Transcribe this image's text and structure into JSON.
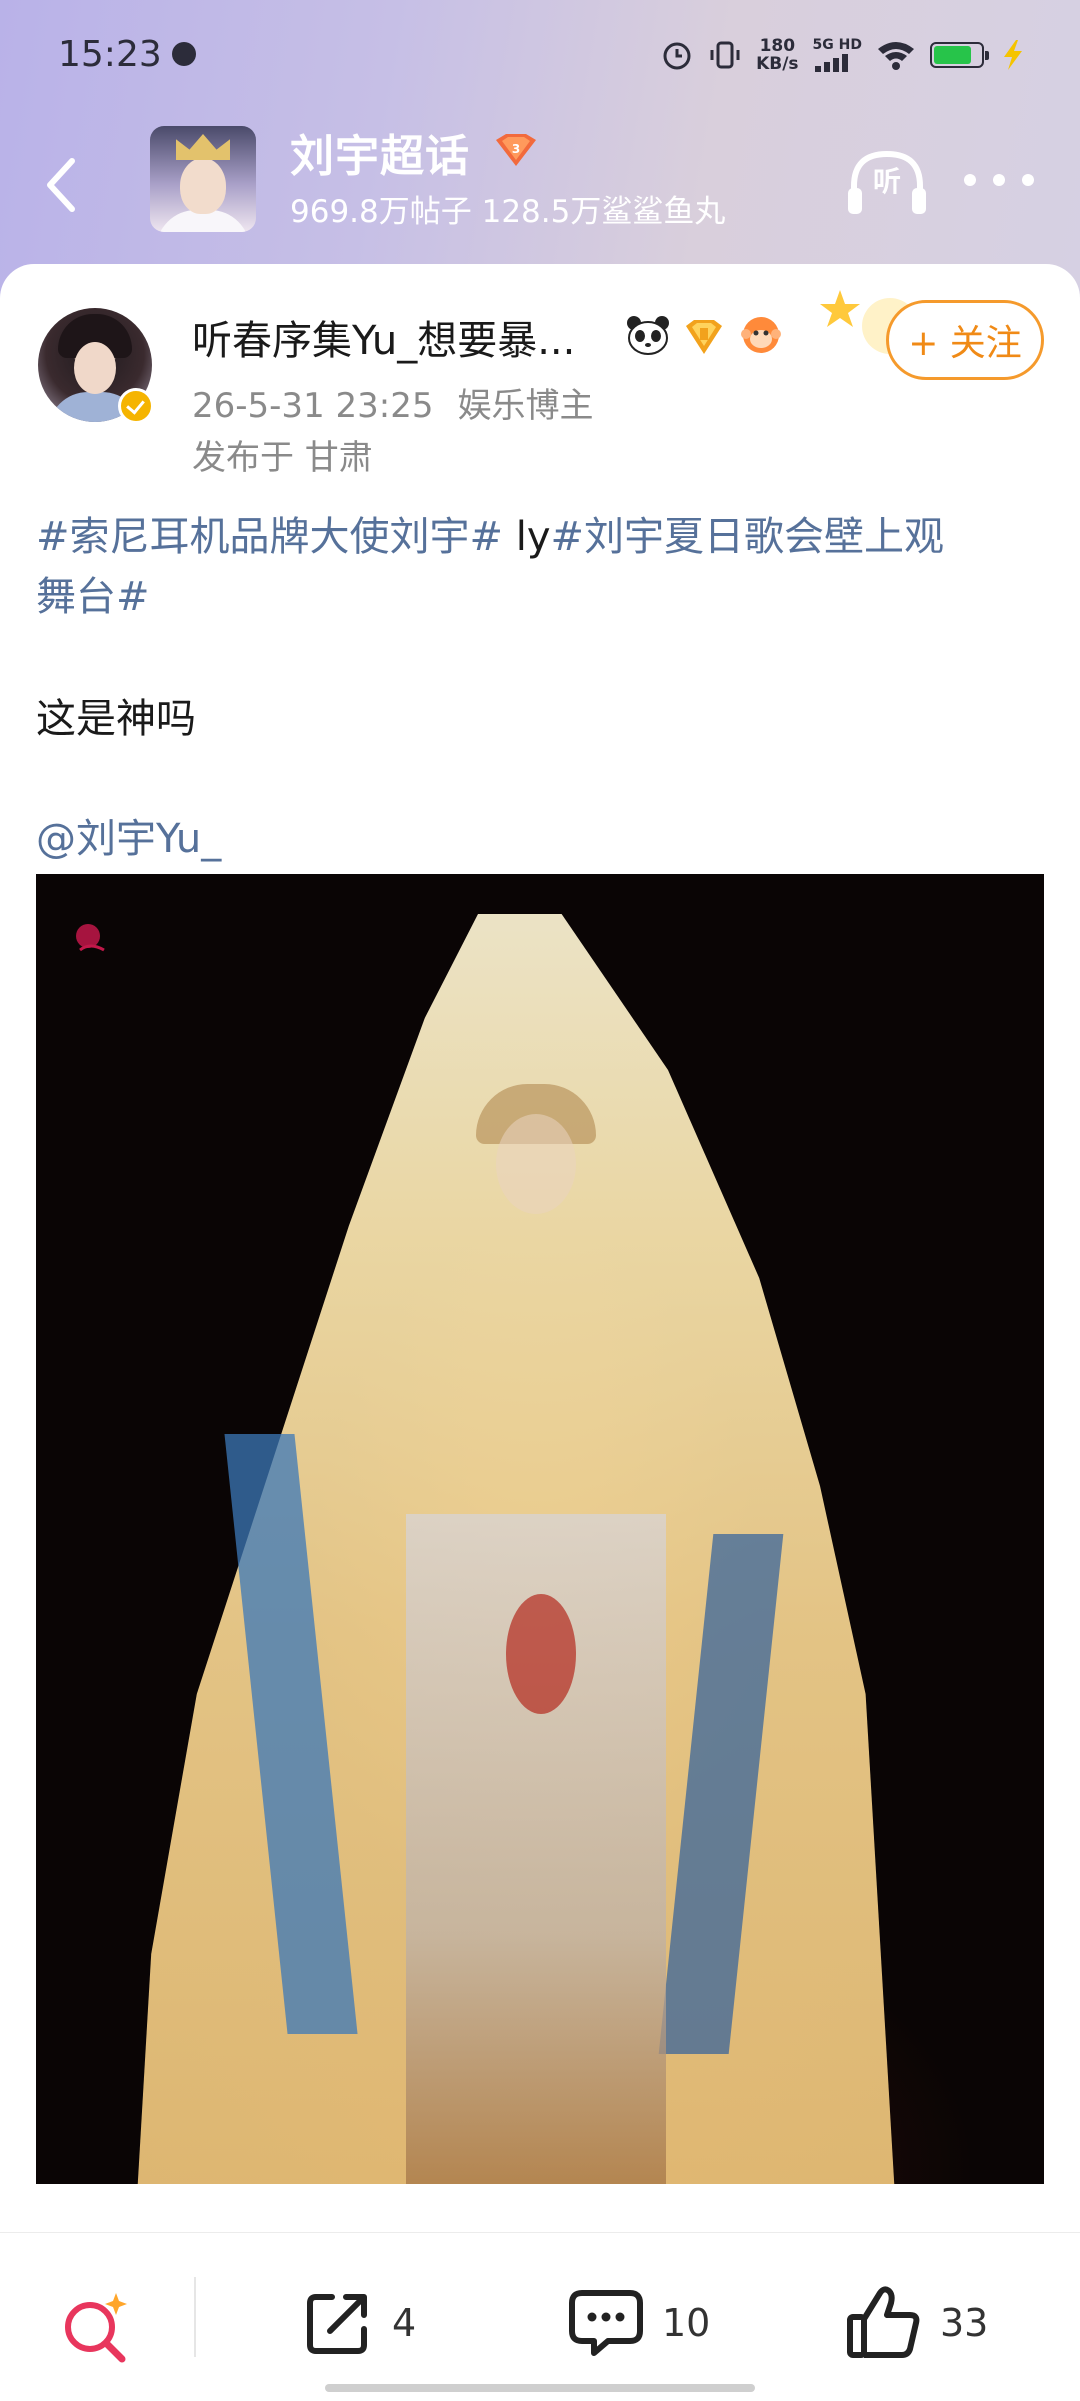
{
  "status_bar": {
    "time": "15:23",
    "net_speed_value": "180",
    "net_speed_unit": "KB/s",
    "signal_label": "5G HD",
    "icons": [
      "alarm-icon",
      "vibrate-icon",
      "signal-icon",
      "wifi-icon",
      "battery-icon",
      "charging-icon"
    ],
    "battery_level": 0.8
  },
  "header": {
    "topic_name": "刘宇超话",
    "topic_stats": "969.8万帖子 128.5万鲨鲨鱼丸",
    "listen_label": "听"
  },
  "post": {
    "author_name": "听春序集Yu_想要暴...",
    "date": "26-5-31 23:25",
    "author_role": "娱乐博主",
    "location": "发布于 甘肃",
    "follow_label": "+ 关注",
    "tag1": "#索尼耳机品牌大使刘宇#",
    "plain_mid": " ly",
    "tag2_line1": "#刘宇夏日歌会壁上观",
    "tag2_line2": "舞台#",
    "body_line": "这是神吗",
    "mention": "@刘宇Yu_"
  },
  "actions": {
    "repost_count": "4",
    "comment_count": "10",
    "like_count": "33"
  },
  "colors": {
    "accent_orange": "#f59a2c",
    "link_blue": "#56719a",
    "header_gradient": "#b9b2e8"
  }
}
